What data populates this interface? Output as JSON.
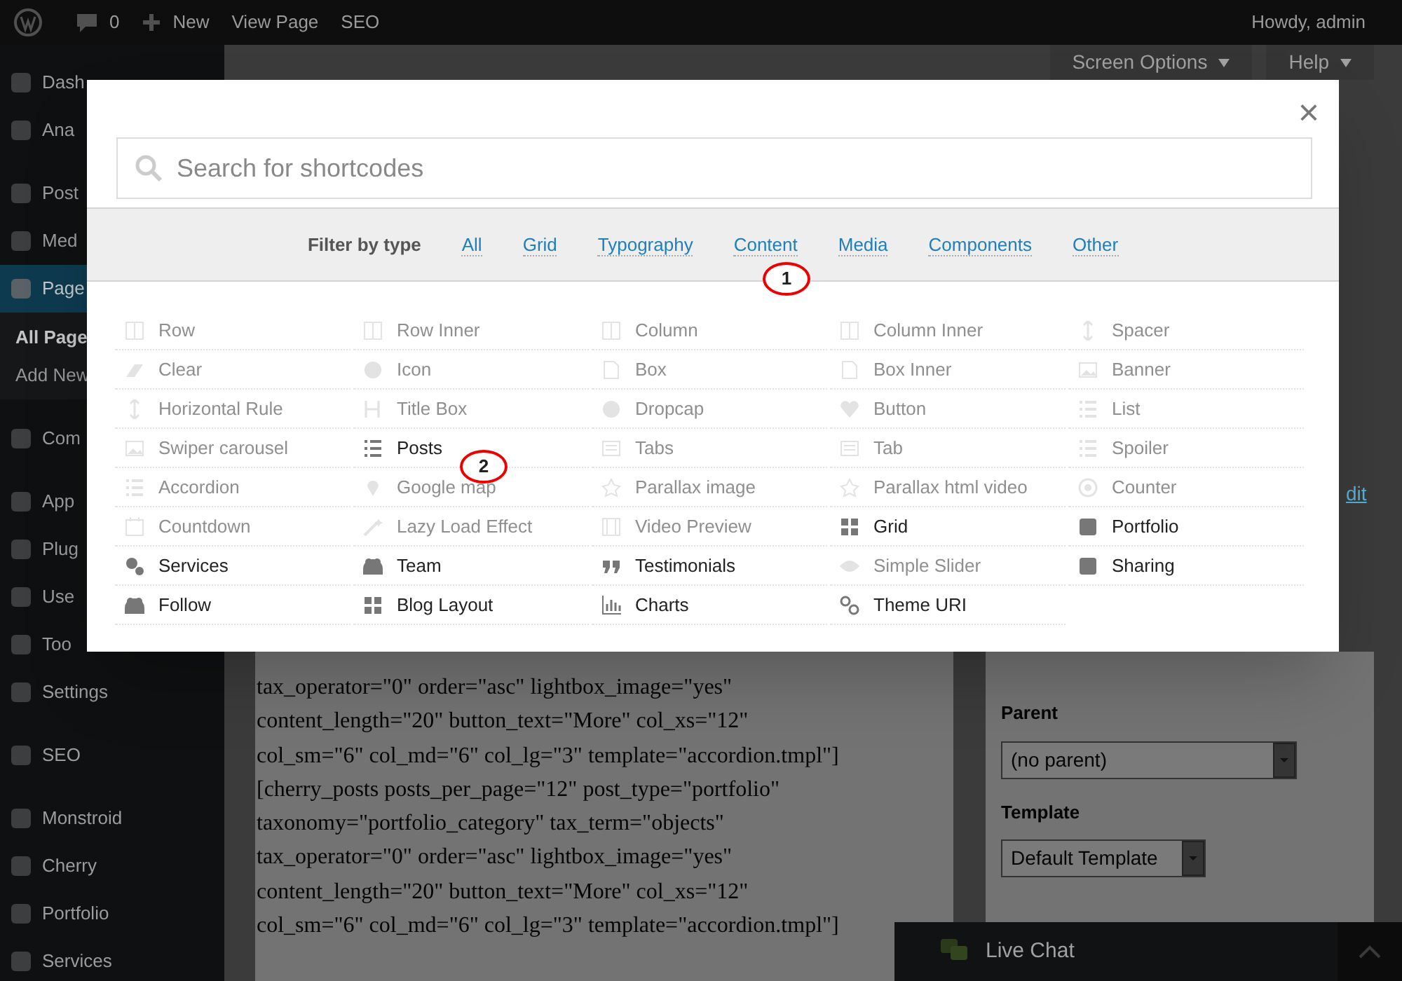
{
  "admin_bar": {
    "comments": "0",
    "new": "New",
    "view": "View Page",
    "seo": "SEO",
    "greeting": "Howdy, admin"
  },
  "sidebar": {
    "groups": [
      [
        {
          "label": "Dash",
          "selected": false
        },
        {
          "label": "Ana",
          "selected": false
        }
      ],
      [
        {
          "label": "Post",
          "selected": false
        },
        {
          "label": "Med",
          "selected": false
        },
        {
          "label": "Page",
          "selected": true,
          "children": [
            {
              "label": "All Page",
              "selected": true
            },
            {
              "label": "Add New",
              "selected": false
            }
          ]
        }
      ],
      [
        {
          "label": "Com",
          "selected": false
        }
      ],
      [
        {
          "label": "App",
          "selected": false
        },
        {
          "label": "Plug",
          "selected": false
        },
        {
          "label": "Use",
          "selected": false
        },
        {
          "label": "Too",
          "selected": false
        },
        {
          "label": "Settings",
          "selected": false
        }
      ],
      [
        {
          "label": "SEO",
          "selected": false
        }
      ],
      [
        {
          "label": "Monstroid",
          "selected": false
        },
        {
          "label": "Cherry",
          "selected": false
        },
        {
          "label": "Portfolio",
          "selected": false
        },
        {
          "label": "Services",
          "selected": false
        }
      ]
    ]
  },
  "header_buttons": [
    "Screen Options",
    "Help"
  ],
  "side_link": "dit",
  "editor_lines": [
    "tax_operator=\"0\" order=\"asc\" lightbox_image=\"yes\"",
    "content_length=\"20\" button_text=\"More\" col_xs=\"12\"",
    "col_sm=\"6\" col_md=\"6\" col_lg=\"3\" template=\"accordion.tmpl\"]",
    "[cherry_posts posts_per_page=\"12\" post_type=\"portfolio\"",
    "taxonomy=\"portfolio_category\" tax_term=\"objects\"",
    "tax_operator=\"0\" order=\"asc\" lightbox_image=\"yes\"",
    "content_length=\"20\" button_text=\"More\" col_xs=\"12\"",
    "col_sm=\"6\" col_md=\"6\" col_lg=\"3\" template=\"accordion.tmpl\"]"
  ],
  "page_attributes": {
    "parent_label": "Parent",
    "parent_value": "(no parent)",
    "template_label": "Template",
    "template_value": "Default Template"
  },
  "live_chat": "Live Chat",
  "modal": {
    "close": "×",
    "search": {
      "placeholder": "Search for shortcodes"
    },
    "filter_label": "Filter by type",
    "filters": [
      "All",
      "Grid",
      "Typography",
      "Content",
      "Media",
      "Components",
      "Other"
    ],
    "items": [
      {
        "label": "Row",
        "disabled": true
      },
      {
        "label": "Row Inner",
        "disabled": true
      },
      {
        "label": "Column",
        "disabled": true
      },
      {
        "label": "Column Inner",
        "disabled": true
      },
      {
        "label": "Spacer",
        "disabled": true
      },
      {
        "label": "Clear",
        "disabled": true
      },
      {
        "label": "Icon",
        "disabled": true
      },
      {
        "label": "Box",
        "disabled": true
      },
      {
        "label": "Box Inner",
        "disabled": true
      },
      {
        "label": "Banner",
        "disabled": true
      },
      {
        "label": "Horizontal Rule",
        "disabled": true
      },
      {
        "label": "Title Box",
        "disabled": true
      },
      {
        "label": "Dropcap",
        "disabled": true
      },
      {
        "label": "Button",
        "disabled": true
      },
      {
        "label": "List",
        "disabled": true
      },
      {
        "label": "Swiper carousel",
        "disabled": true
      },
      {
        "label": "Posts",
        "disabled": false
      },
      {
        "label": "Tabs",
        "disabled": true
      },
      {
        "label": "Tab",
        "disabled": true
      },
      {
        "label": "Spoiler",
        "disabled": true
      },
      {
        "label": "Accordion",
        "disabled": true
      },
      {
        "label": "Google map",
        "disabled": true
      },
      {
        "label": "Parallax image",
        "disabled": true
      },
      {
        "label": "Parallax html video",
        "disabled": true
      },
      {
        "label": "Counter",
        "disabled": true
      },
      {
        "label": "Countdown",
        "disabled": true
      },
      {
        "label": "Lazy Load Effect",
        "disabled": true
      },
      {
        "label": "Video Preview",
        "disabled": true
      },
      {
        "label": "Grid",
        "disabled": false
      },
      {
        "label": "Portfolio",
        "disabled": false
      },
      {
        "label": "Services",
        "disabled": false
      },
      {
        "label": "Team",
        "disabled": false
      },
      {
        "label": "Testimonials",
        "disabled": false
      },
      {
        "label": "Simple Slider",
        "disabled": true
      },
      {
        "label": "Sharing",
        "disabled": false
      },
      {
        "label": "Follow",
        "disabled": false
      },
      {
        "label": "Blog Layout",
        "disabled": false
      },
      {
        "label": "Charts",
        "disabled": false
      },
      {
        "label": "Theme URI",
        "disabled": false
      }
    ]
  },
  "callouts": [
    {
      "number": "1"
    },
    {
      "number": "2"
    }
  ]
}
